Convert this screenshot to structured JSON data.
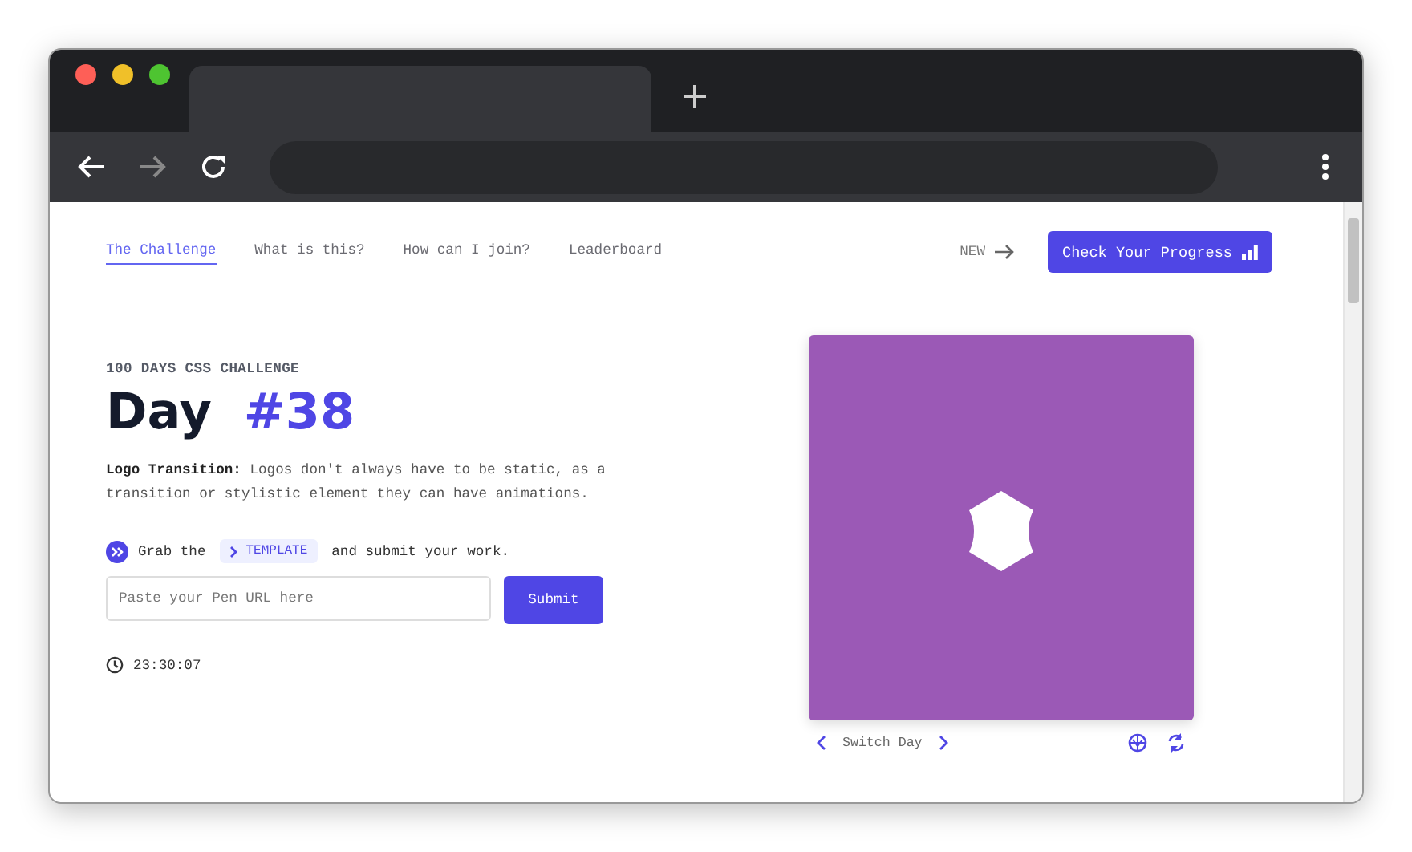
{
  "nav_links": [
    {
      "label": "The Challenge",
      "selected": true
    },
    {
      "label": "What is this?",
      "selected": false
    },
    {
      "label": "How can I join?",
      "selected": false
    },
    {
      "label": "Leaderboard",
      "selected": false
    }
  ],
  "new_label": "NEW",
  "progress_button": "Check Your Progress",
  "eyebrow": "100 DAYS CSS CHALLENGE",
  "title": {
    "day": "Day",
    "number": "#38"
  },
  "description": "**Logo Transition:** Logos don't always have to be static, as a transition or stylistic element they can have animations.",
  "grab": {
    "before": "Grab the",
    "template": "TEMPLATE",
    "after": "and submit your work."
  },
  "url_field": {
    "placeholder": "Paste your Pen URL here"
  },
  "submit_button": "Submit",
  "timer": "23:30:07",
  "switch_day": "Switch Day"
}
